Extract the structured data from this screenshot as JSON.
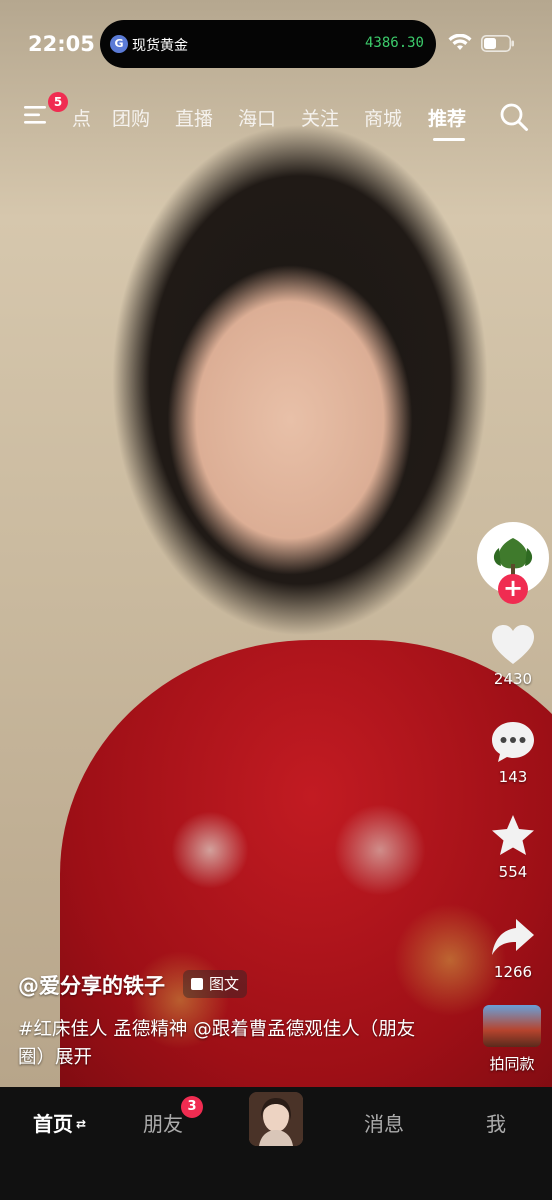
{
  "status_bar": {
    "time": "22:05",
    "island_title": "现货黄金",
    "island_price": "4386.30",
    "island_icon": "gold-icon",
    "island_price_color": "#3ccb6b"
  },
  "top_nav": {
    "menu_badge": "5",
    "tabs": [
      {
        "label": "点"
      },
      {
        "label": "团购"
      },
      {
        "label": "直播"
      },
      {
        "label": "海口"
      },
      {
        "label": "关注"
      },
      {
        "label": "商城"
      },
      {
        "label": "推荐",
        "active": true
      }
    ]
  },
  "side_actions": {
    "like_count": "2430",
    "comment_count": "143",
    "favorite_count": "554",
    "share_count": "1266"
  },
  "caption": {
    "author": "@爱分享的铁子",
    "badge": "图文",
    "text": "#红床佳人 孟德精神 @跟着曹孟德观佳人（朋友圈）展开"
  },
  "same_style_label": "拍同款",
  "bottom_tabs": {
    "home": "首页",
    "home_arrows": "⇄",
    "friends": "朋友",
    "friends_badge": "3",
    "messages": "消息",
    "me": "我"
  },
  "colors": {
    "accent": "#f02c51",
    "bottom_bar": "#111111"
  }
}
